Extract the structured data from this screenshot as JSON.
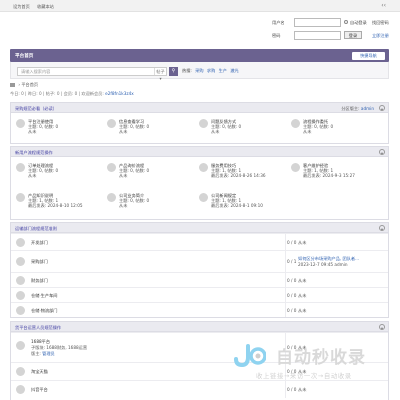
{
  "topbar": {
    "links": [
      "设为首页",
      "收藏本站"
    ],
    "toggle_icon": "double-chevron-icon"
  },
  "login": {
    "username_label": "用户名",
    "remember_label": "自动登录",
    "forgot_label": "找回密码",
    "password_label": "密码",
    "login_button": "登录",
    "register_label": "立即注册"
  },
  "nav": {
    "title": "平台首页",
    "quick_nav": "快捷导航"
  },
  "search": {
    "placeholder": "请输入搜索内容",
    "scope": "帖子",
    "hot_label": "热搜:",
    "hot_terms": [
      "采购",
      "求购",
      "生产",
      "激光"
    ]
  },
  "breadcrumb": {
    "label": "平台首页"
  },
  "toolbar": {
    "text": "今日: 0 | 昨日: 0 | 帖子: 0 | 会员: 0 | 欢迎新会员:",
    "newest": "e2f8fn1k3z4x"
  },
  "sections": [
    {
      "title": "采购规范必看（必读）",
      "moderator_label": "分区版主:",
      "moderator": "admin",
      "forums": [
        {
          "name": "平台注册使用",
          "stats": "主题: 0, 帖数: 0",
          "last": "从未"
        },
        {
          "name": "信息查看学习",
          "stats": "主题: 0, 帖数: 0",
          "last": "从未"
        },
        {
          "name": "问题反馈方式",
          "stats": "主题: 0, 帖数: 0",
          "last": "从未"
        },
        {
          "name": "流程操作委托",
          "stats": "主题: 0, 帖数: 0",
          "last": "从未"
        }
      ]
    },
    {
      "title": "新用户流程规范操作",
      "forums": [
        {
          "name": "订单处理流程",
          "stats": "主题: 0, 帖数: 0",
          "last": "从未"
        },
        {
          "name": "产品询价流程",
          "stats": "主题: 0, 帖数: 0",
          "last": "从未"
        },
        {
          "name": "服务费用技巧",
          "stats": "主题: 1, 帖数: 1",
          "last": "最后发表: 2024-8-26 14:36"
        },
        {
          "name": "客户维护经验",
          "stats": "主题: 1, 帖数: 1",
          "last": "最后发表: 2024-9-3 15:27"
        },
        {
          "name": "产品知识说明",
          "stats": "主题: 1, 帖数: 1",
          "last": "最后发表: 2024-8-10 12:05"
        },
        {
          "name": "公司业务简介",
          "stats": "主题: 0, 帖数: 0",
          "last": "从未"
        },
        {
          "name": "公司新闻规定",
          "stats": "主题: 1, 帖数: 1",
          "last": "最后发表: 2024-8-1 09:10"
        }
      ]
    },
    {
      "title": "运输部门流程规范准则",
      "forums": [
        {
          "name": "开发部门",
          "count": "0 / 0",
          "last": "从未"
        },
        {
          "name": "采购部门",
          "count": "0 / 1",
          "last_title": "如何区分市场采购产品, 团队者...",
          "last_time": "2023-12-7 09:45 admin"
        },
        {
          "name": "财务部门",
          "count": "0 / 0",
          "last": "从未"
        },
        {
          "name": "仓储·生产车间",
          "count": "0 / 0",
          "last": "从未"
        },
        {
          "name": "仓储·物流部门",
          "count": "0 / 0",
          "last": "从未"
        }
      ]
    },
    {
      "title": "货平台运营人员规范操作",
      "forums": [
        {
          "name": "1688平台",
          "sub1": "子版块: 1688财务, 1688运营",
          "sub2_label": "版主:",
          "sub2": "管理员",
          "count": "0 / 0",
          "last": "从未"
        },
        {
          "name": "淘宝天猫",
          "count": "0 / 0",
          "last": "从未"
        },
        {
          "name": "抖音平台",
          "count": "0 / 0",
          "last": "从未"
        }
      ]
    }
  ],
  "watermark": {
    "brand": "自动秒收录",
    "slogan": "收上链接→来访一次→自动收录"
  }
}
